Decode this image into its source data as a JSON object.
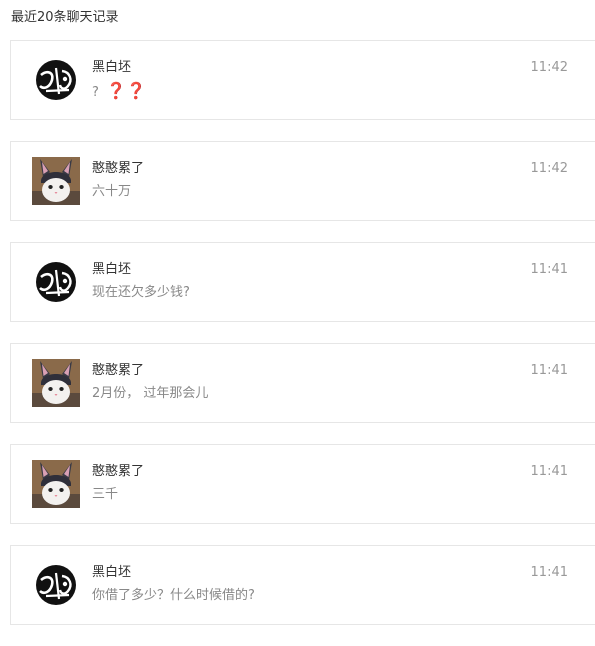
{
  "section_title": "最近20条聊天记录",
  "colors": {
    "emoji_question": "#cc1a1a",
    "border": "#e6e6e6",
    "preview_text": "#888888"
  },
  "messages": [
    {
      "avatar": "ink-calligraphy-avatar",
      "name": "黑白坯",
      "time": "11:42",
      "preview": "?",
      "emoji": "❓❓"
    },
    {
      "avatar": "cat-bunny-ears-avatar",
      "name": "憨憨累了",
      "time": "11:42",
      "preview": "六十万"
    },
    {
      "avatar": "ink-calligraphy-avatar",
      "name": "黑白坯",
      "time": "11:41",
      "preview": "现在还欠多少钱?"
    },
    {
      "avatar": "cat-bunny-ears-avatar",
      "name": "憨憨累了",
      "time": "11:41",
      "preview": "2月份， 过年那会儿"
    },
    {
      "avatar": "cat-bunny-ears-avatar",
      "name": "憨憨累了",
      "time": "11:41",
      "preview": "三千"
    },
    {
      "avatar": "ink-calligraphy-avatar",
      "name": "黑白坯",
      "time": "11:41",
      "preview": "你借了多少？什么时候借的?"
    }
  ]
}
